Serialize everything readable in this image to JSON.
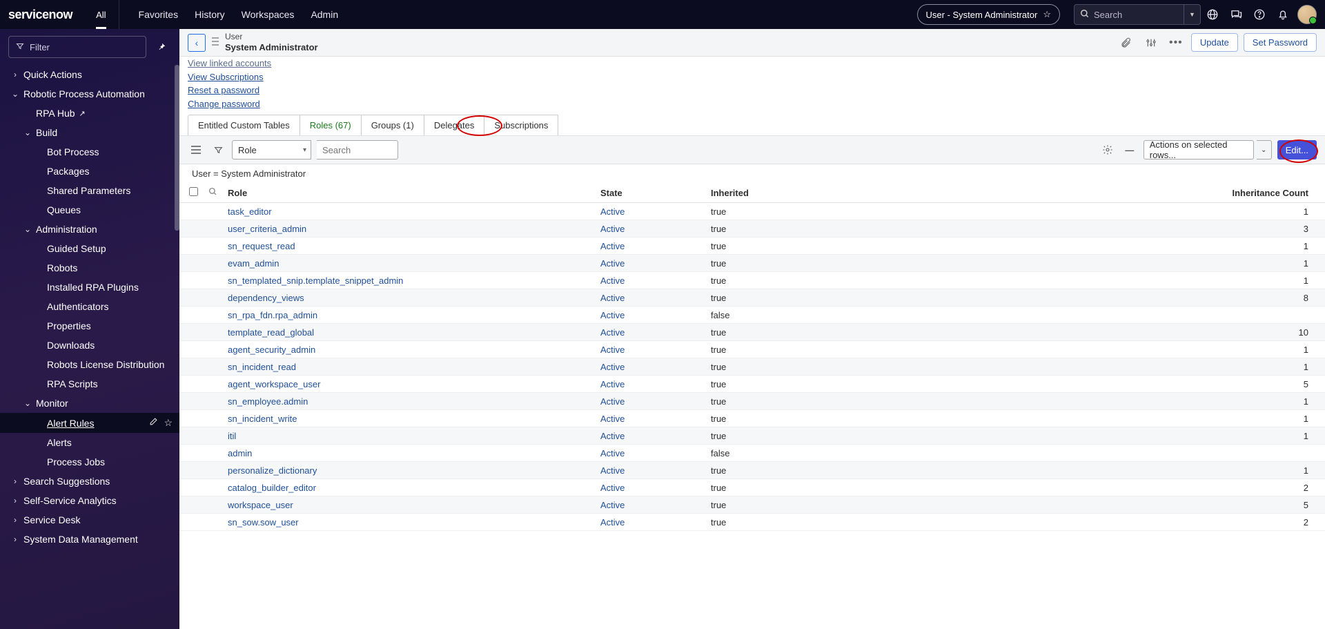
{
  "topbar": {
    "logo_text": "servicenow",
    "all_tab": "All",
    "nav": [
      "Favorites",
      "History",
      "Workspaces",
      "Admin"
    ],
    "impersonate": "User - System Administrator",
    "search_placeholder": "Search"
  },
  "sidebar": {
    "filter_label": "Filter",
    "items": [
      {
        "label": "Quick Actions",
        "level": 0,
        "chev": "right",
        "leaf": false
      },
      {
        "label": "Robotic Process Automation",
        "level": 0,
        "chev": "down",
        "leaf": false
      },
      {
        "label": "RPA Hub",
        "level": 1,
        "chev": "",
        "leaf": true,
        "ext": true
      },
      {
        "label": "Build",
        "level": 1,
        "chev": "down",
        "leaf": false
      },
      {
        "label": "Bot Process",
        "level": 2,
        "chev": "",
        "leaf": true
      },
      {
        "label": "Packages",
        "level": 2,
        "chev": "",
        "leaf": true
      },
      {
        "label": "Shared Parameters",
        "level": 2,
        "chev": "",
        "leaf": true
      },
      {
        "label": "Queues",
        "level": 2,
        "chev": "",
        "leaf": true
      },
      {
        "label": "Administration",
        "level": 1,
        "chev": "down",
        "leaf": false
      },
      {
        "label": "Guided Setup",
        "level": 2,
        "chev": "",
        "leaf": true
      },
      {
        "label": "Robots",
        "level": 2,
        "chev": "",
        "leaf": true
      },
      {
        "label": "Installed RPA Plugins",
        "level": 2,
        "chev": "",
        "leaf": true
      },
      {
        "label": "Authenticators",
        "level": 2,
        "chev": "",
        "leaf": true
      },
      {
        "label": "Properties",
        "level": 2,
        "chev": "",
        "leaf": true
      },
      {
        "label": "Downloads",
        "level": 2,
        "chev": "",
        "leaf": true
      },
      {
        "label": "Robots License Distribution",
        "level": 2,
        "chev": "",
        "leaf": true
      },
      {
        "label": "RPA Scripts",
        "level": 2,
        "chev": "",
        "leaf": true
      },
      {
        "label": "Monitor",
        "level": 1,
        "chev": "down",
        "leaf": false
      },
      {
        "label": "Alert Rules",
        "level": 2,
        "chev": "",
        "leaf": true,
        "active": true
      },
      {
        "label": "Alerts",
        "level": 2,
        "chev": "",
        "leaf": true
      },
      {
        "label": "Process Jobs",
        "level": 2,
        "chev": "",
        "leaf": true
      },
      {
        "label": "Search Suggestions",
        "level": 0,
        "chev": "right",
        "leaf": false
      },
      {
        "label": "Self-Service Analytics",
        "level": 0,
        "chev": "right",
        "leaf": false
      },
      {
        "label": "Service Desk",
        "level": 0,
        "chev": "right",
        "leaf": false
      },
      {
        "label": "System Data Management",
        "level": 0,
        "chev": "right",
        "leaf": false
      }
    ]
  },
  "record_header": {
    "table": "User",
    "display": "System Administrator",
    "update": "Update",
    "set_password": "Set Password"
  },
  "related_links": {
    "l1": "View linked accounts",
    "l2": "View Subscriptions",
    "l3": "Reset a password",
    "l4": "Change password"
  },
  "tabs": {
    "t0": "Entitled Custom Tables",
    "t1": "Roles (67)",
    "t2": "Groups (1)",
    "t3": "Delegates",
    "t4": "Subscriptions"
  },
  "list_toolbar": {
    "field": "Role",
    "search_placeholder": "Search",
    "actions": "Actions on selected rows...",
    "edit": "Edit..."
  },
  "breadcrumb": "User = System Administrator",
  "columns": {
    "c0": "Role",
    "c1": "State",
    "c2": "Inherited",
    "c3": "Inheritance Count"
  },
  "rows": [
    {
      "role": "task_editor",
      "state": "Active",
      "inherited": "true",
      "count": "1"
    },
    {
      "role": "user_criteria_admin",
      "state": "Active",
      "inherited": "true",
      "count": "3"
    },
    {
      "role": "sn_request_read",
      "state": "Active",
      "inherited": "true",
      "count": "1"
    },
    {
      "role": "evam_admin",
      "state": "Active",
      "inherited": "true",
      "count": "1"
    },
    {
      "role": "sn_templated_snip.template_snippet_admin",
      "state": "Active",
      "inherited": "true",
      "count": "1"
    },
    {
      "role": "dependency_views",
      "state": "Active",
      "inherited": "true",
      "count": "8"
    },
    {
      "role": "sn_rpa_fdn.rpa_admin",
      "state": "Active",
      "inherited": "false",
      "count": ""
    },
    {
      "role": "template_read_global",
      "state": "Active",
      "inherited": "true",
      "count": "10"
    },
    {
      "role": "agent_security_admin",
      "state": "Active",
      "inherited": "true",
      "count": "1"
    },
    {
      "role": "sn_incident_read",
      "state": "Active",
      "inherited": "true",
      "count": "1"
    },
    {
      "role": "agent_workspace_user",
      "state": "Active",
      "inherited": "true",
      "count": "5"
    },
    {
      "role": "sn_employee.admin",
      "state": "Active",
      "inherited": "true",
      "count": "1"
    },
    {
      "role": "sn_incident_write",
      "state": "Active",
      "inherited": "true",
      "count": "1"
    },
    {
      "role": "itil",
      "state": "Active",
      "inherited": "true",
      "count": "1"
    },
    {
      "role": "admin",
      "state": "Active",
      "inherited": "false",
      "count": ""
    },
    {
      "role": "personalize_dictionary",
      "state": "Active",
      "inherited": "true",
      "count": "1"
    },
    {
      "role": "catalog_builder_editor",
      "state": "Active",
      "inherited": "true",
      "count": "2"
    },
    {
      "role": "workspace_user",
      "state": "Active",
      "inherited": "true",
      "count": "5"
    },
    {
      "role": "sn_sow.sow_user",
      "state": "Active",
      "inherited": "true",
      "count": "2"
    }
  ]
}
